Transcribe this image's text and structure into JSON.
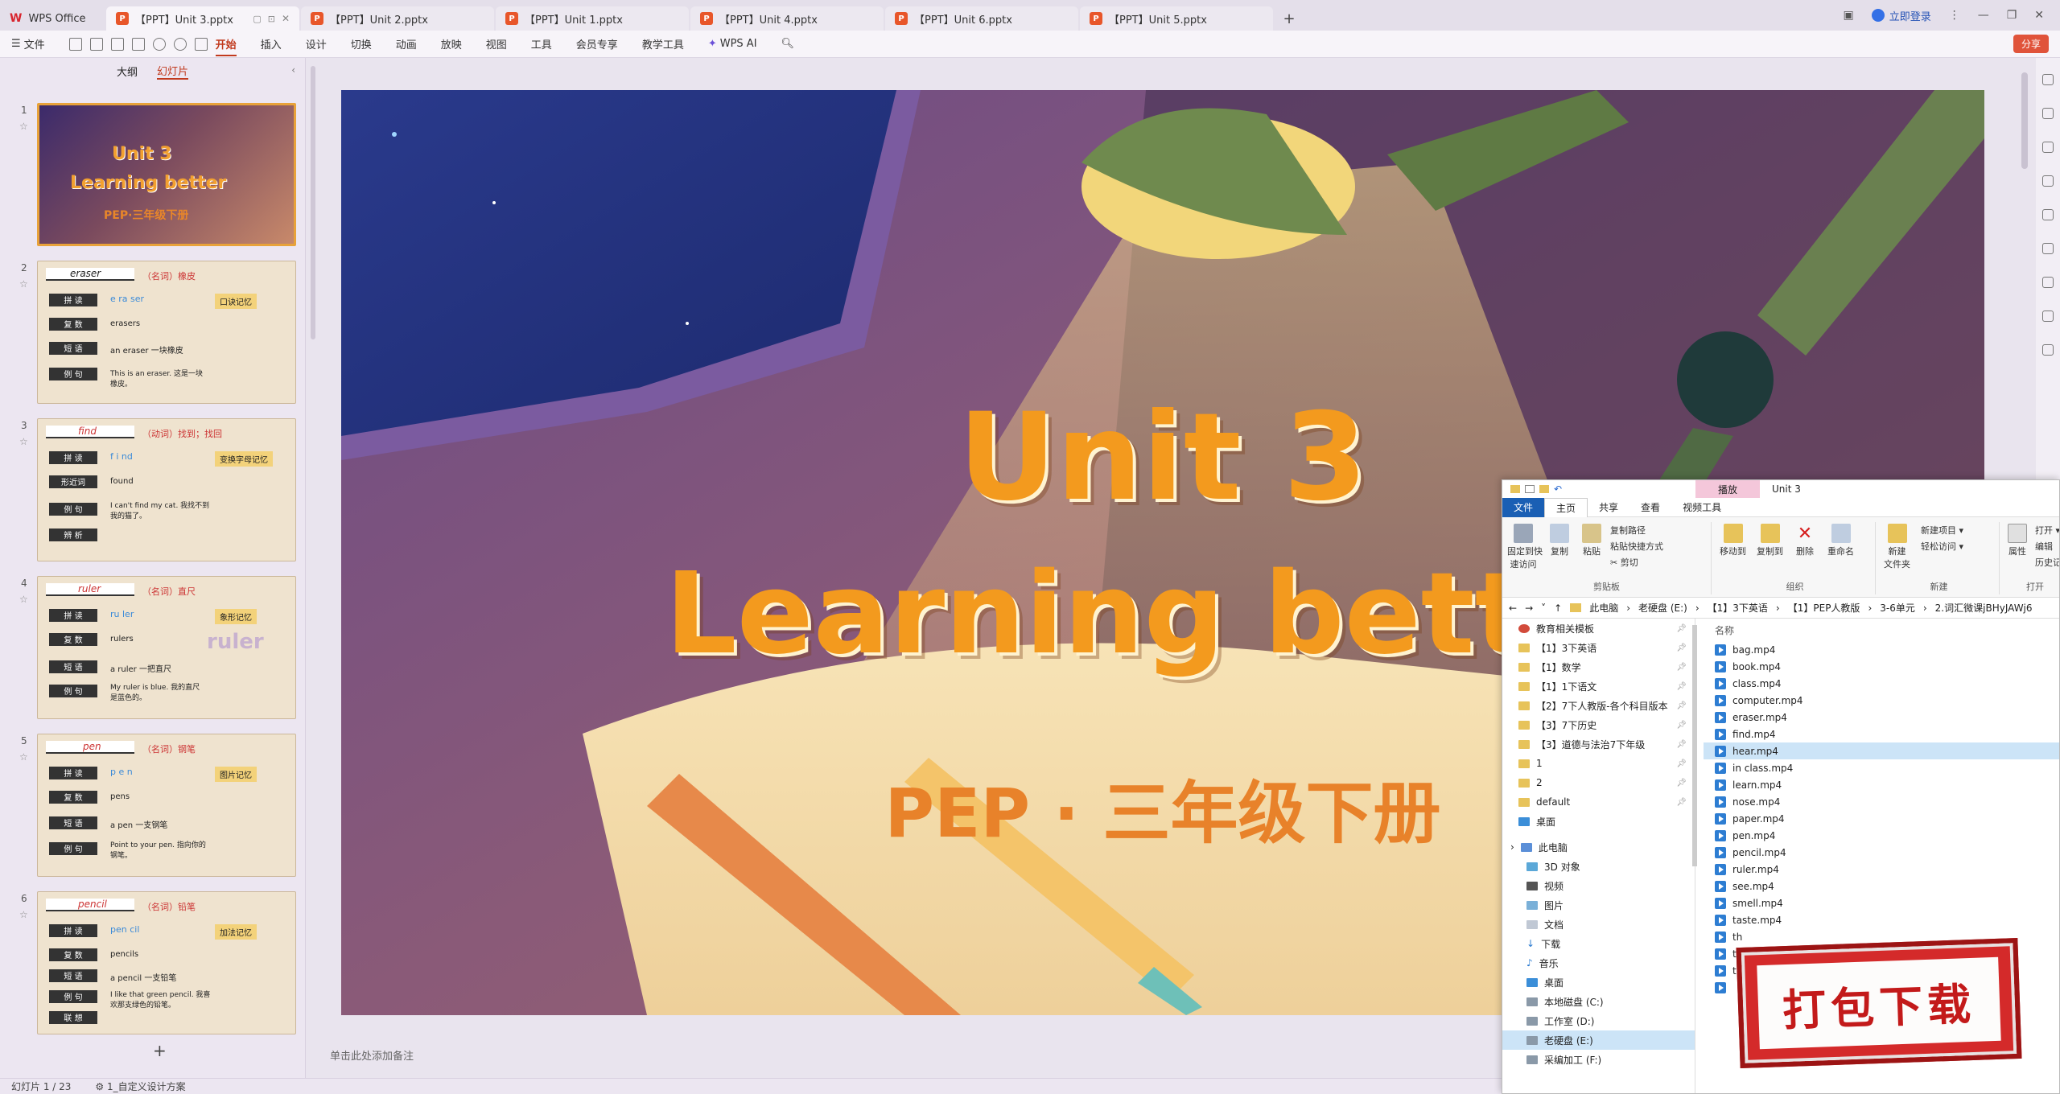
{
  "tabs": [
    {
      "label": "WPS Office"
    },
    {
      "label": "【PPT】Unit 3.pptx"
    },
    {
      "label": "【PPT】Unit 2.pptx"
    },
    {
      "label": "【PPT】Unit 1.pptx"
    },
    {
      "label": "【PPT】Unit 4.pptx"
    },
    {
      "label": "【PPT】Unit 6.pptx"
    },
    {
      "label": "【PPT】Unit 5.pptx"
    }
  ],
  "login_label": "立即登录",
  "ribbon": {
    "file": "文件",
    "items": [
      "开始",
      "插入",
      "设计",
      "切换",
      "动画",
      "放映",
      "视图",
      "工具",
      "会员专享",
      "教学工具"
    ],
    "wps_ai": "WPS AI",
    "share": "分享"
  },
  "left_panel": {
    "tab_outline": "大纲",
    "tab_slides": "幻灯片",
    "add": "+"
  },
  "thumbs": [
    {
      "num": "1",
      "title": "Unit 3",
      "sub": "Learning better",
      "tag": "PEP·三年级下册"
    },
    {
      "num": "2",
      "word": "eraser",
      "pos": "（名词）橡皮",
      "spell": "e ra ser",
      "plural": "erasers",
      "memo": "口诀记忆",
      "phrase": "an eraser 一块橡皮",
      "ex": "This is an eraser. 这是一块橡皮。"
    },
    {
      "num": "3",
      "word": "find",
      "pos": "（动词）找到；找回",
      "spell": "f i nd",
      "memo": "变换字母记忆",
      "past": "found",
      "ex": "I can't find my cat. 我找不到我的猫了。"
    },
    {
      "num": "4",
      "word": "ruler",
      "pos": "（名词）直尺",
      "spell": "ru ler",
      "plural": "rulers",
      "memo": "象形记忆",
      "phrase": "a ruler 一把直尺",
      "ex": "My ruler is blue. 我的直尺是蓝色的。"
    },
    {
      "num": "5",
      "word": "pen",
      "pos": "（名词）钢笔",
      "spell": "p e n",
      "plural": "pens",
      "memo": "图片记忆",
      "phrase": "a pen 一支钢笔",
      "ex": "Point to your pen. 指向你的钢笔。"
    },
    {
      "num": "6",
      "word": "pencil",
      "pos": "（名词）铅笔",
      "spell": "pen cil",
      "plural": "pencils",
      "memo": "加法记忆",
      "phrase": "a pencil 一支铅笔",
      "ex": "I like that green pencil. 我喜欢那支绿色的铅笔。"
    }
  ],
  "slide": {
    "title_line1": "Unit 3",
    "title_line2": "Learning better",
    "subtitle": "PEP · 三年级下册"
  },
  "notes_placeholder": "单击此处添加备注",
  "status": {
    "slide_count": "幻灯片 1 / 23",
    "design": "1_自定义设计方案"
  },
  "explorer": {
    "play_tab": "播放",
    "window_name": "Unit 3",
    "tabs": [
      "文件",
      "主页",
      "共享",
      "查看",
      "视频工具"
    ],
    "ribbon_buttons": {
      "pin": "固定到快\n速访问",
      "copy": "复制",
      "paste": "粘贴",
      "copy_path": "复制路径",
      "paste_shortcut": "粘贴快捷方式",
      "cut": "剪切",
      "move_to": "移动到",
      "copy_to": "复制到",
      "delete": "删除",
      "rename": "重命名",
      "new_folder": "新建\n文件夹",
      "new_item": "新建项目",
      "easy_access": "轻松访问",
      "properties": "属性",
      "open": "打开",
      "edit": "编辑",
      "history": "历史记录"
    },
    "groups": [
      "剪贴板",
      "组织",
      "新建",
      "打开"
    ],
    "address": [
      "此电脑",
      "老硬盘 (E:)",
      "【1】3下英语",
      "【1】PEP人教版",
      "3-6单元",
      "2.词汇微课jBHyJAWj6"
    ],
    "nav": [
      "教育相关模板",
      "【1】3下英语",
      "【1】数学",
      "【1】1下语文",
      "【2】7下人教版-各个科目版本",
      "【3】7下历史",
      "【3】道德与法治7下年级",
      "1",
      "2",
      "default",
      "桌面",
      "此电脑",
      "3D 对象",
      "视频",
      "图片",
      "文档",
      "下载",
      "音乐",
      "桌面",
      "本地磁盘 (C:)",
      "工作室 (D:)",
      "老硬盘 (E:)",
      "采编加工 (F:)"
    ],
    "col_name": "名称",
    "files": [
      "bag.mp4",
      "book.mp4",
      "class.mp4",
      "computer.mp4",
      "eraser.mp4",
      "find.mp4",
      "hear.mp4",
      "in class.mp4",
      "learn.mp4",
      "nose.mp4",
      "paper.mp4",
      "pen.mp4",
      "pencil.mp4",
      "ruler.mp4",
      "see.mp4",
      "smell.mp4",
      "taste.mp4",
      "th",
      "to",
      "to",
      ""
    ]
  },
  "stamp_text": "打包下载"
}
